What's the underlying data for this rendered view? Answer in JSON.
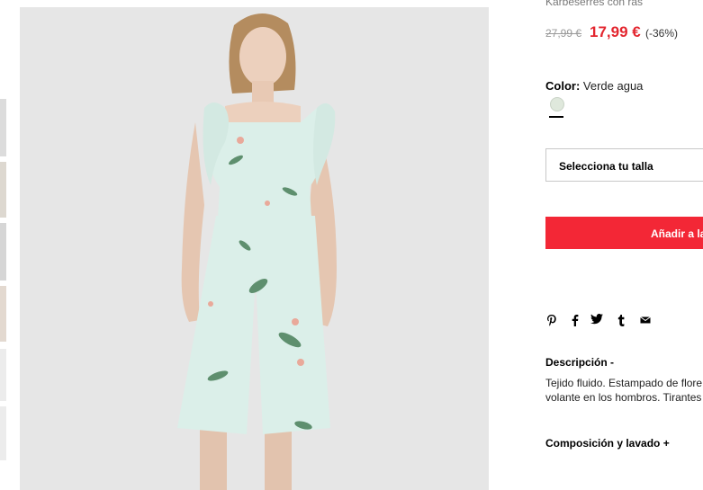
{
  "product": {
    "title_cut": "Karbeserres con ras",
    "old_price": "27,99 €",
    "new_price": "17,99 €",
    "discount": "(-36%)",
    "color_label": "Color:",
    "color_value": "Verde agua",
    "swatch_color": "#dfe8dc",
    "size_placeholder": "Selecciona tu talla",
    "add_button": "Añadir a la",
    "brand_red": "#f32736"
  },
  "share": {
    "icons": [
      "pinterest-icon",
      "facebook-icon",
      "twitter-icon",
      "tumblr-icon",
      "email-icon"
    ]
  },
  "description": {
    "title": "Descripción -",
    "line1": "Tejido fluido. Estampado de flore",
    "line2": "volante en los hombros. Tirantes"
  },
  "composition": {
    "title": "Composición y lavado +"
  }
}
